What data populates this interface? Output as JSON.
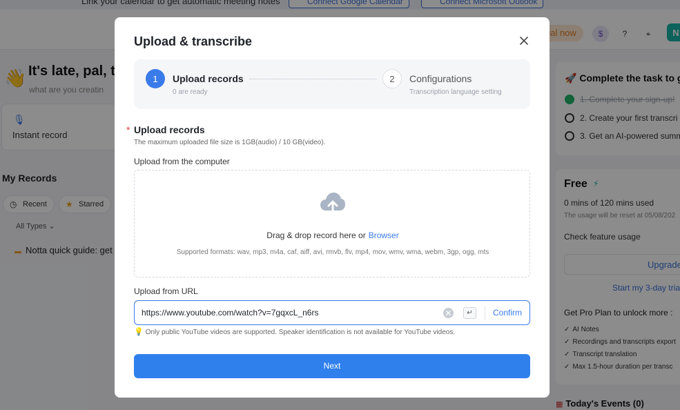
{
  "background": {
    "banner": {
      "text": "Link your calendar to get automatic meeting notes",
      "google_button": "Connect Google Calendar",
      "outlook_button": "Connect Microsoft Outlook"
    },
    "header": {
      "trial_chip": "rial now",
      "avatar_letter": "N"
    },
    "greeting": {
      "title": "It's late, pal, t",
      "subtitle": "what are you creatin"
    },
    "instant_record_label": "Instant record",
    "my_records_title": "My Records",
    "filters": {
      "recent": "Recent",
      "starred": "Starred",
      "all_types": "All Types"
    },
    "record_item": "Notta quick guide: get",
    "tasks": {
      "title": "Complete the task to g",
      "items": [
        "1. Complete your sign-up!",
        "2. Create your first transcri",
        "3. Get an AI-powered summ"
      ]
    },
    "plan": {
      "name": "Free",
      "usage": "0 mins of 120 mins used",
      "reset": "The usage will be reset at 05/08/202",
      "check_usage": "Check feature usage",
      "upgrade": "Upgrade",
      "trial_link": "Start my 3-day tria",
      "pro_title": "Get Pro Plan to unlock more :",
      "pro_items": [
        "AI Notes",
        "Recordings and transcripts export",
        "Transcript translation",
        "Max 1.5-hour duration per transc"
      ]
    },
    "events_title": "Today's Events (0)"
  },
  "modal": {
    "title": "Upload & transcribe",
    "steps": [
      {
        "number": "1",
        "label": "Upload records",
        "sub": "0 are ready"
      },
      {
        "number": "2",
        "label": "Configurations",
        "sub": "Transcription language setting"
      }
    ],
    "section": {
      "required_mark": "*",
      "title": "Upload records",
      "subtitle": "The maximum uploaded file size is 1GB(audio) / 10 GB(video)."
    },
    "computer": {
      "label": "Upload from the computer",
      "drop_text": "Drag & drop record here or",
      "browse": "Browser",
      "formats": "Supported formats: wav, mp3, m4a, caf, aiff, avi, rmvb, flv, mp4, mov, wmv, wma, webm, 3gp, ogg, mts"
    },
    "url": {
      "label": "Upload from URL",
      "value": "https://www.youtube.com/watch?v=7gqxcL_n6rs",
      "enter_glyph": "↵",
      "confirm": "Confirm",
      "hint": "Only public YouTube videos are supported. Speaker identification is not available for YouTube videos."
    },
    "next_button": "Next"
  },
  "colors": {
    "primary": "#2f80ed",
    "step_active": "#3a7bea",
    "required": "#e23c3c",
    "hint_bulb": "#f2b01e"
  }
}
